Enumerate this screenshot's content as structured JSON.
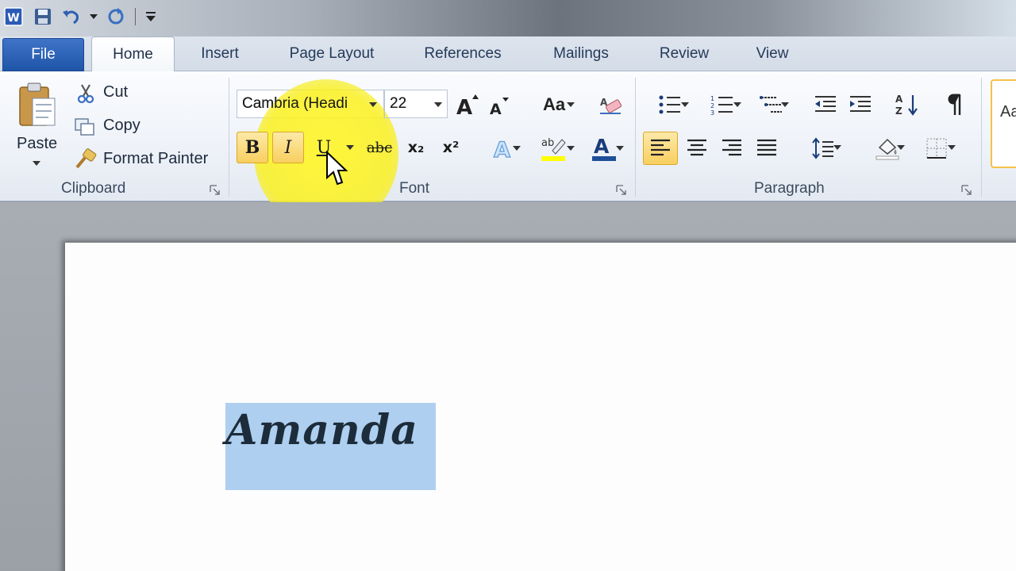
{
  "app": {
    "name": "Microsoft Word",
    "logo_letter": "W"
  },
  "tabs": {
    "file": "File",
    "items": [
      "Home",
      "Insert",
      "Page Layout",
      "References",
      "Mailings",
      "Review",
      "View"
    ],
    "active": "Home"
  },
  "clipboard": {
    "paste": "Paste",
    "cut": "Cut",
    "copy": "Copy",
    "format_painter": "Format Painter",
    "group_label": "Clipboard"
  },
  "font": {
    "font_name": "Cambria (Headi",
    "font_size": "22",
    "change_case": "Aa",
    "bold": "B",
    "italic": "I",
    "underline": "U",
    "strikethrough": "abc",
    "subscript": "x₂",
    "superscript": "x²",
    "group_label": "Font",
    "active_buttons": [
      "bold",
      "italic"
    ]
  },
  "paragraph": {
    "group_label": "Paragraph",
    "active_alignment": "left"
  },
  "styles": {
    "preview": "Aa"
  },
  "document": {
    "selected_text": "Amanda"
  },
  "colors": {
    "file_tab": "#2a60b8",
    "highlight_yellow": "#f5ee2a",
    "selection": "#aecfef",
    "active_button": "#f8cf5f",
    "font_color_bar": "#1f4e99",
    "highlighter_bar": "#ffff00"
  },
  "icons": [
    "word-logo-icon",
    "save-icon",
    "undo-icon",
    "redo-icon",
    "customize-qat-icon",
    "paste-icon",
    "cut-icon",
    "copy-icon",
    "format-painter-icon",
    "grow-font-icon",
    "shrink-font-icon",
    "change-case-icon",
    "clear-formatting-icon",
    "text-effects-icon",
    "highlight-color-icon",
    "font-color-icon",
    "bullets-icon",
    "numbering-icon",
    "multilevel-list-icon",
    "decrease-indent-icon",
    "increase-indent-icon",
    "sort-icon",
    "show-marks-icon",
    "align-left-icon",
    "center-icon",
    "align-right-icon",
    "justify-icon",
    "line-spacing-icon",
    "shading-icon",
    "borders-icon",
    "mouse-pointer-icon"
  ]
}
